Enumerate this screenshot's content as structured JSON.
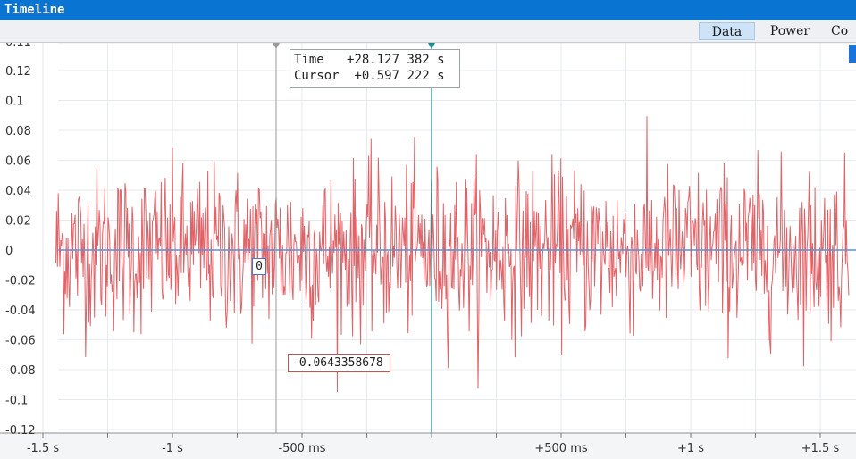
{
  "window": {
    "title": "Timeline"
  },
  "tabs": [
    {
      "label": "Data",
      "active": true
    },
    {
      "label": "Power",
      "active": false
    },
    {
      "label": "Co",
      "active": false
    }
  ],
  "cursor_readout": {
    "time_label": "Time",
    "time_value": "+28.127 382 s",
    "cursor_label": "Cursor",
    "cursor_value": "+0.597 222 s"
  },
  "zero_marker": "0",
  "value_label": "-0.0643358678",
  "colors": {
    "signal": "#e06368",
    "zero_line": "#5b8ed6",
    "cursor": "#1b8a8a",
    "marker": "#9a9a9a",
    "titlebar": "#0a74d2"
  },
  "chart_data": {
    "type": "line",
    "title": "",
    "xlabel": "",
    "ylabel": "",
    "xlim": [
      -1.55,
      1.55
    ],
    "ylim": [
      -0.12,
      0.11
    ],
    "y_ticks": [
      {
        "value": 0.11,
        "label": "0.11"
      },
      {
        "value": 0.12,
        "label": "0.12"
      },
      {
        "value": 0.1,
        "label": "0.1"
      },
      {
        "value": 0.08,
        "label": "0.08"
      },
      {
        "value": 0.06,
        "label": "0.06"
      },
      {
        "value": 0.04,
        "label": "0.04"
      },
      {
        "value": 0.02,
        "label": "0.02"
      },
      {
        "value": 0,
        "label": "0"
      },
      {
        "value": -0.02,
        "label": "-0.02"
      },
      {
        "value": -0.04,
        "label": "-0.04"
      },
      {
        "value": -0.06,
        "label": "-0.06"
      },
      {
        "value": -0.08,
        "label": "-0.08"
      },
      {
        "value": -0.1,
        "label": "-0.1"
      },
      {
        "value": -0.12,
        "label": "-0.12"
      }
    ],
    "x_ticks": [
      {
        "value": -1.5,
        "label": "-1.5 s"
      },
      {
        "value": -1.0,
        "label": "-1 s"
      },
      {
        "value": -0.5,
        "label": "-500 ms"
      },
      {
        "value": 0.5,
        "label": "+500 ms"
      },
      {
        "value": 1.0,
        "label": "+1 s"
      },
      {
        "value": 1.5,
        "label": "+1.5 s"
      }
    ],
    "grid": true,
    "markers": [
      {
        "name": "reference",
        "x": -0.6
      },
      {
        "name": "cursor",
        "x": 0.0
      }
    ],
    "series": [
      {
        "kind": "noise",
        "amplitude": 0.065,
        "x_start": -1.45,
        "x_end": 1.55
      }
    ]
  }
}
